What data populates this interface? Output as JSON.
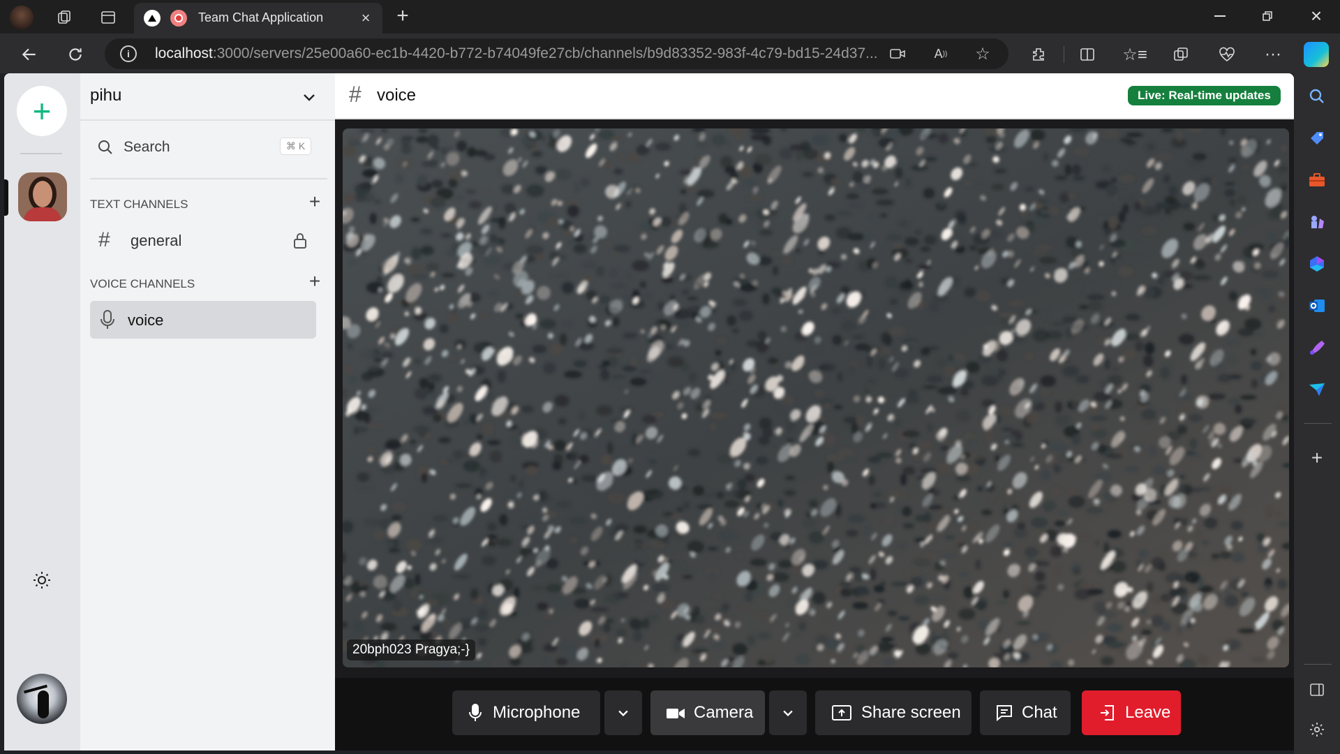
{
  "browser": {
    "tab_title": "Team Chat Application",
    "url_host": "localhost",
    "url_rest": ":3000/servers/25e00a60-ec1b-4420-b772-b74049fe27cb/channels/b9d83352-983f-4c79-bd15-24d37..."
  },
  "server": {
    "name": "pihu",
    "search_label": "Search",
    "search_shortcut": "⌘ K",
    "text_channels_label": "TEXT CHANNELS",
    "voice_channels_label": "VOICE CHANNELS",
    "text_channels": [
      {
        "name": "general"
      }
    ],
    "voice_channels": [
      {
        "name": "voice"
      }
    ]
  },
  "channel": {
    "name": "voice",
    "live_badge": "Live: Real-time updates",
    "colors": {
      "badge": "#15803d",
      "leave": "#e11d2c"
    }
  },
  "video": {
    "participant_name": "20bph023 Pragya;-}"
  },
  "controls": {
    "microphone": "Microphone",
    "camera": "Camera",
    "share_screen": "Share screen",
    "chat": "Chat",
    "leave": "Leave"
  }
}
